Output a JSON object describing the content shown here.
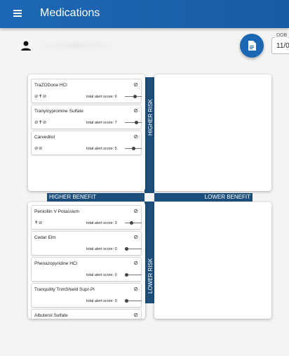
{
  "app": {
    "title": "Medications"
  },
  "patient": {
    "dob_label": "DOB",
    "dob_value": "11/0"
  },
  "quadrants": {
    "higher_risk_label": "HIGHER RISK",
    "lower_risk_label": "LOWER RISK",
    "higher_benefit_label": "HIGHER BENEFIT",
    "lower_benefit_label": "LOWER BENEFIT"
  },
  "score_prefix": "total alert score:",
  "top_left_cards": [
    {
      "name": "TraZODone HCl",
      "symbols": "⊘✝⊘",
      "score": "6",
      "score_fraction": 0.6
    },
    {
      "name": "Tranylcypromine Sulfate",
      "symbols": "⊘✝⊘",
      "score": "7",
      "score_fraction": 0.7
    },
    {
      "name": "Carvedilol",
      "symbols": "⊘⊘",
      "score": "5",
      "score_fraction": 0.5
    }
  ],
  "bottom_left_cards": [
    {
      "name": "Penicillin V Potassium",
      "symbols": "✝⊘",
      "score": "3",
      "score_fraction": 0.35
    },
    {
      "name": "Cedar Elm",
      "symbols": "",
      "score": "0",
      "score_fraction": 0.0
    },
    {
      "name": "Phenazopyridine HCl",
      "symbols": "",
      "score": "0",
      "score_fraction": 0.0
    },
    {
      "name": "Tranquility TrimShield Supr-Pl",
      "symbols": "",
      "score": "0",
      "score_fraction": 0.0
    },
    {
      "name": "Albuterol Sulfate",
      "symbols": "",
      "score": "",
      "score_fraction": 0.0
    }
  ]
}
